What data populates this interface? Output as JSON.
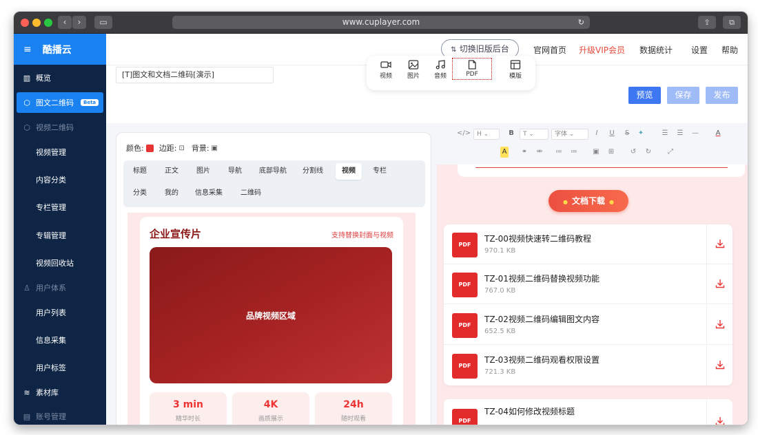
{
  "browser": {
    "url": "www.cuplayer.com"
  },
  "sidebar": {
    "brand": "酷播云",
    "items": [
      {
        "label": "概览",
        "icon": "bar-chart-icon"
      },
      {
        "label": "图文二维码",
        "badge": "Beta",
        "icon": "cube-icon"
      },
      {
        "label": "视频二维码",
        "icon": "cube-icon"
      },
      {
        "label": "视频管理"
      },
      {
        "label": "内容分类"
      },
      {
        "label": "专栏管理"
      },
      {
        "label": "专辑管理"
      },
      {
        "label": "视频回收站"
      },
      {
        "label": "用户体系",
        "icon": "user-icon"
      },
      {
        "label": "用户列表"
      },
      {
        "label": "信息采集"
      },
      {
        "label": "用户标签"
      },
      {
        "label": "素材库",
        "icon": "layers-icon"
      },
      {
        "label": "账号管理",
        "icon": "id-card-icon"
      }
    ]
  },
  "topnav": {
    "switch_label": "切换旧版后台",
    "links": [
      "官网首页",
      "升级VIP会员",
      "数据统计",
      "设置",
      "帮助"
    ],
    "vip_color": "#e64a3b"
  },
  "editor": {
    "title_value": "[T]图文和文档二维码[演示]",
    "media_tools": [
      "视频",
      "图片",
      "音频",
      "PDF",
      "模版"
    ],
    "actions": {
      "preview": "预览",
      "save": "保存",
      "publish": "发布"
    }
  },
  "props": {
    "color_label": "颜色:",
    "margin_label": "边距:",
    "bg_label": "背景:",
    "color_value": "#e63333"
  },
  "component_tabs": [
    "标题",
    "正文",
    "图片",
    "导航",
    "底部导航",
    "分割线",
    "视频",
    "专栏",
    "分类",
    "我的",
    "信息采集",
    "二维码"
  ],
  "video_card": {
    "title": "企业宣传片",
    "link": "支持替换封面与视频",
    "box_label": "品牌视频区域",
    "stats": [
      {
        "value": "3 min",
        "label": "精华时长"
      },
      {
        "value": "4K",
        "label": "画质展示"
      },
      {
        "value": "24h",
        "label": "随时观看"
      }
    ]
  },
  "rich_toolbar": {
    "heading": "H",
    "font_size": "T",
    "font_family": "字体"
  },
  "download": {
    "button": "文档下载",
    "files": [
      {
        "type": "PDF",
        "name": "TZ-00视频快速转二维码教程",
        "size": "970.1 KB"
      },
      {
        "type": "PDF",
        "name": "TZ-01视频二维码替换视频功能",
        "size": "767.0 KB"
      },
      {
        "type": "PDF",
        "name": "TZ-02视频二维码编辑图文内容",
        "size": "652.5 KB"
      },
      {
        "type": "PDF",
        "name": "TZ-03视频二维码观看权限设置",
        "size": "721.3 KB"
      },
      {
        "type": "PDF",
        "name": "TZ-04如何修改视频标题"
      }
    ]
  }
}
